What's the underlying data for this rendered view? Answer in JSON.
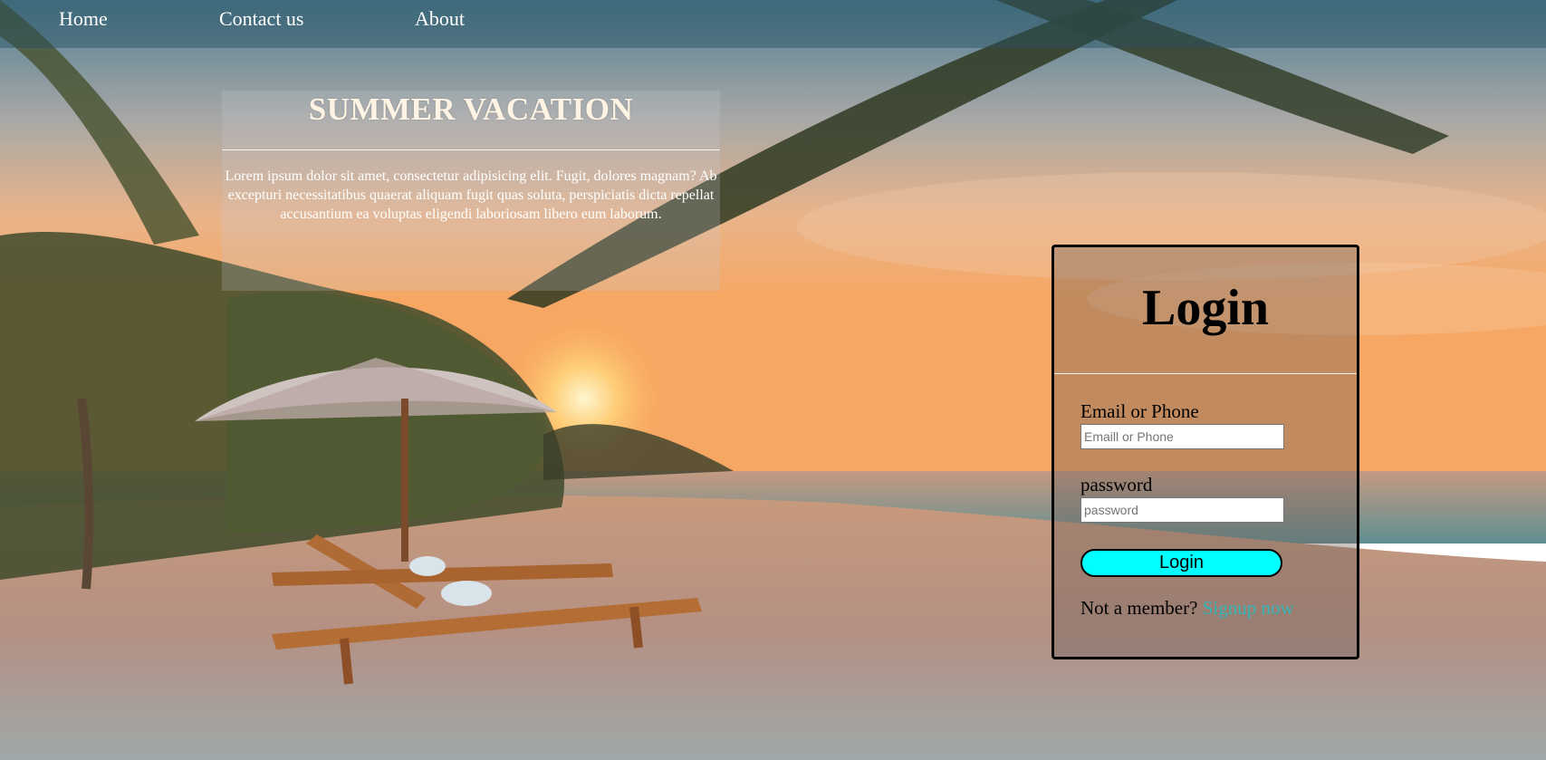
{
  "nav": {
    "home": "Home",
    "contact": "Contact us",
    "about": "About"
  },
  "hero": {
    "title": "SUMMER VACATION",
    "body": "Lorem ipsum dolor sit amet, consectetur adipisicing elit. Fugit, dolores magnam? Ab excepturi necessitatibus quaerat aliquam fugit quas soluta, perspiciatis dicta repellat accusantium ea voluptas eligendi laboriosam libero eum laborum."
  },
  "login": {
    "title": "Login",
    "email_label": "Email or Phone",
    "email_placeholder": "Emaill or Phone",
    "password_label": "password",
    "password_placeholder": "password",
    "button_label": "Login",
    "signup_prompt": "Not a member?",
    "signup_link": "Signup now"
  },
  "colors": {
    "button_bg": "#00ffff",
    "link": "#33b6b6",
    "card_border": "#000000"
  },
  "background": {
    "icon": "beach-sunset-image"
  }
}
